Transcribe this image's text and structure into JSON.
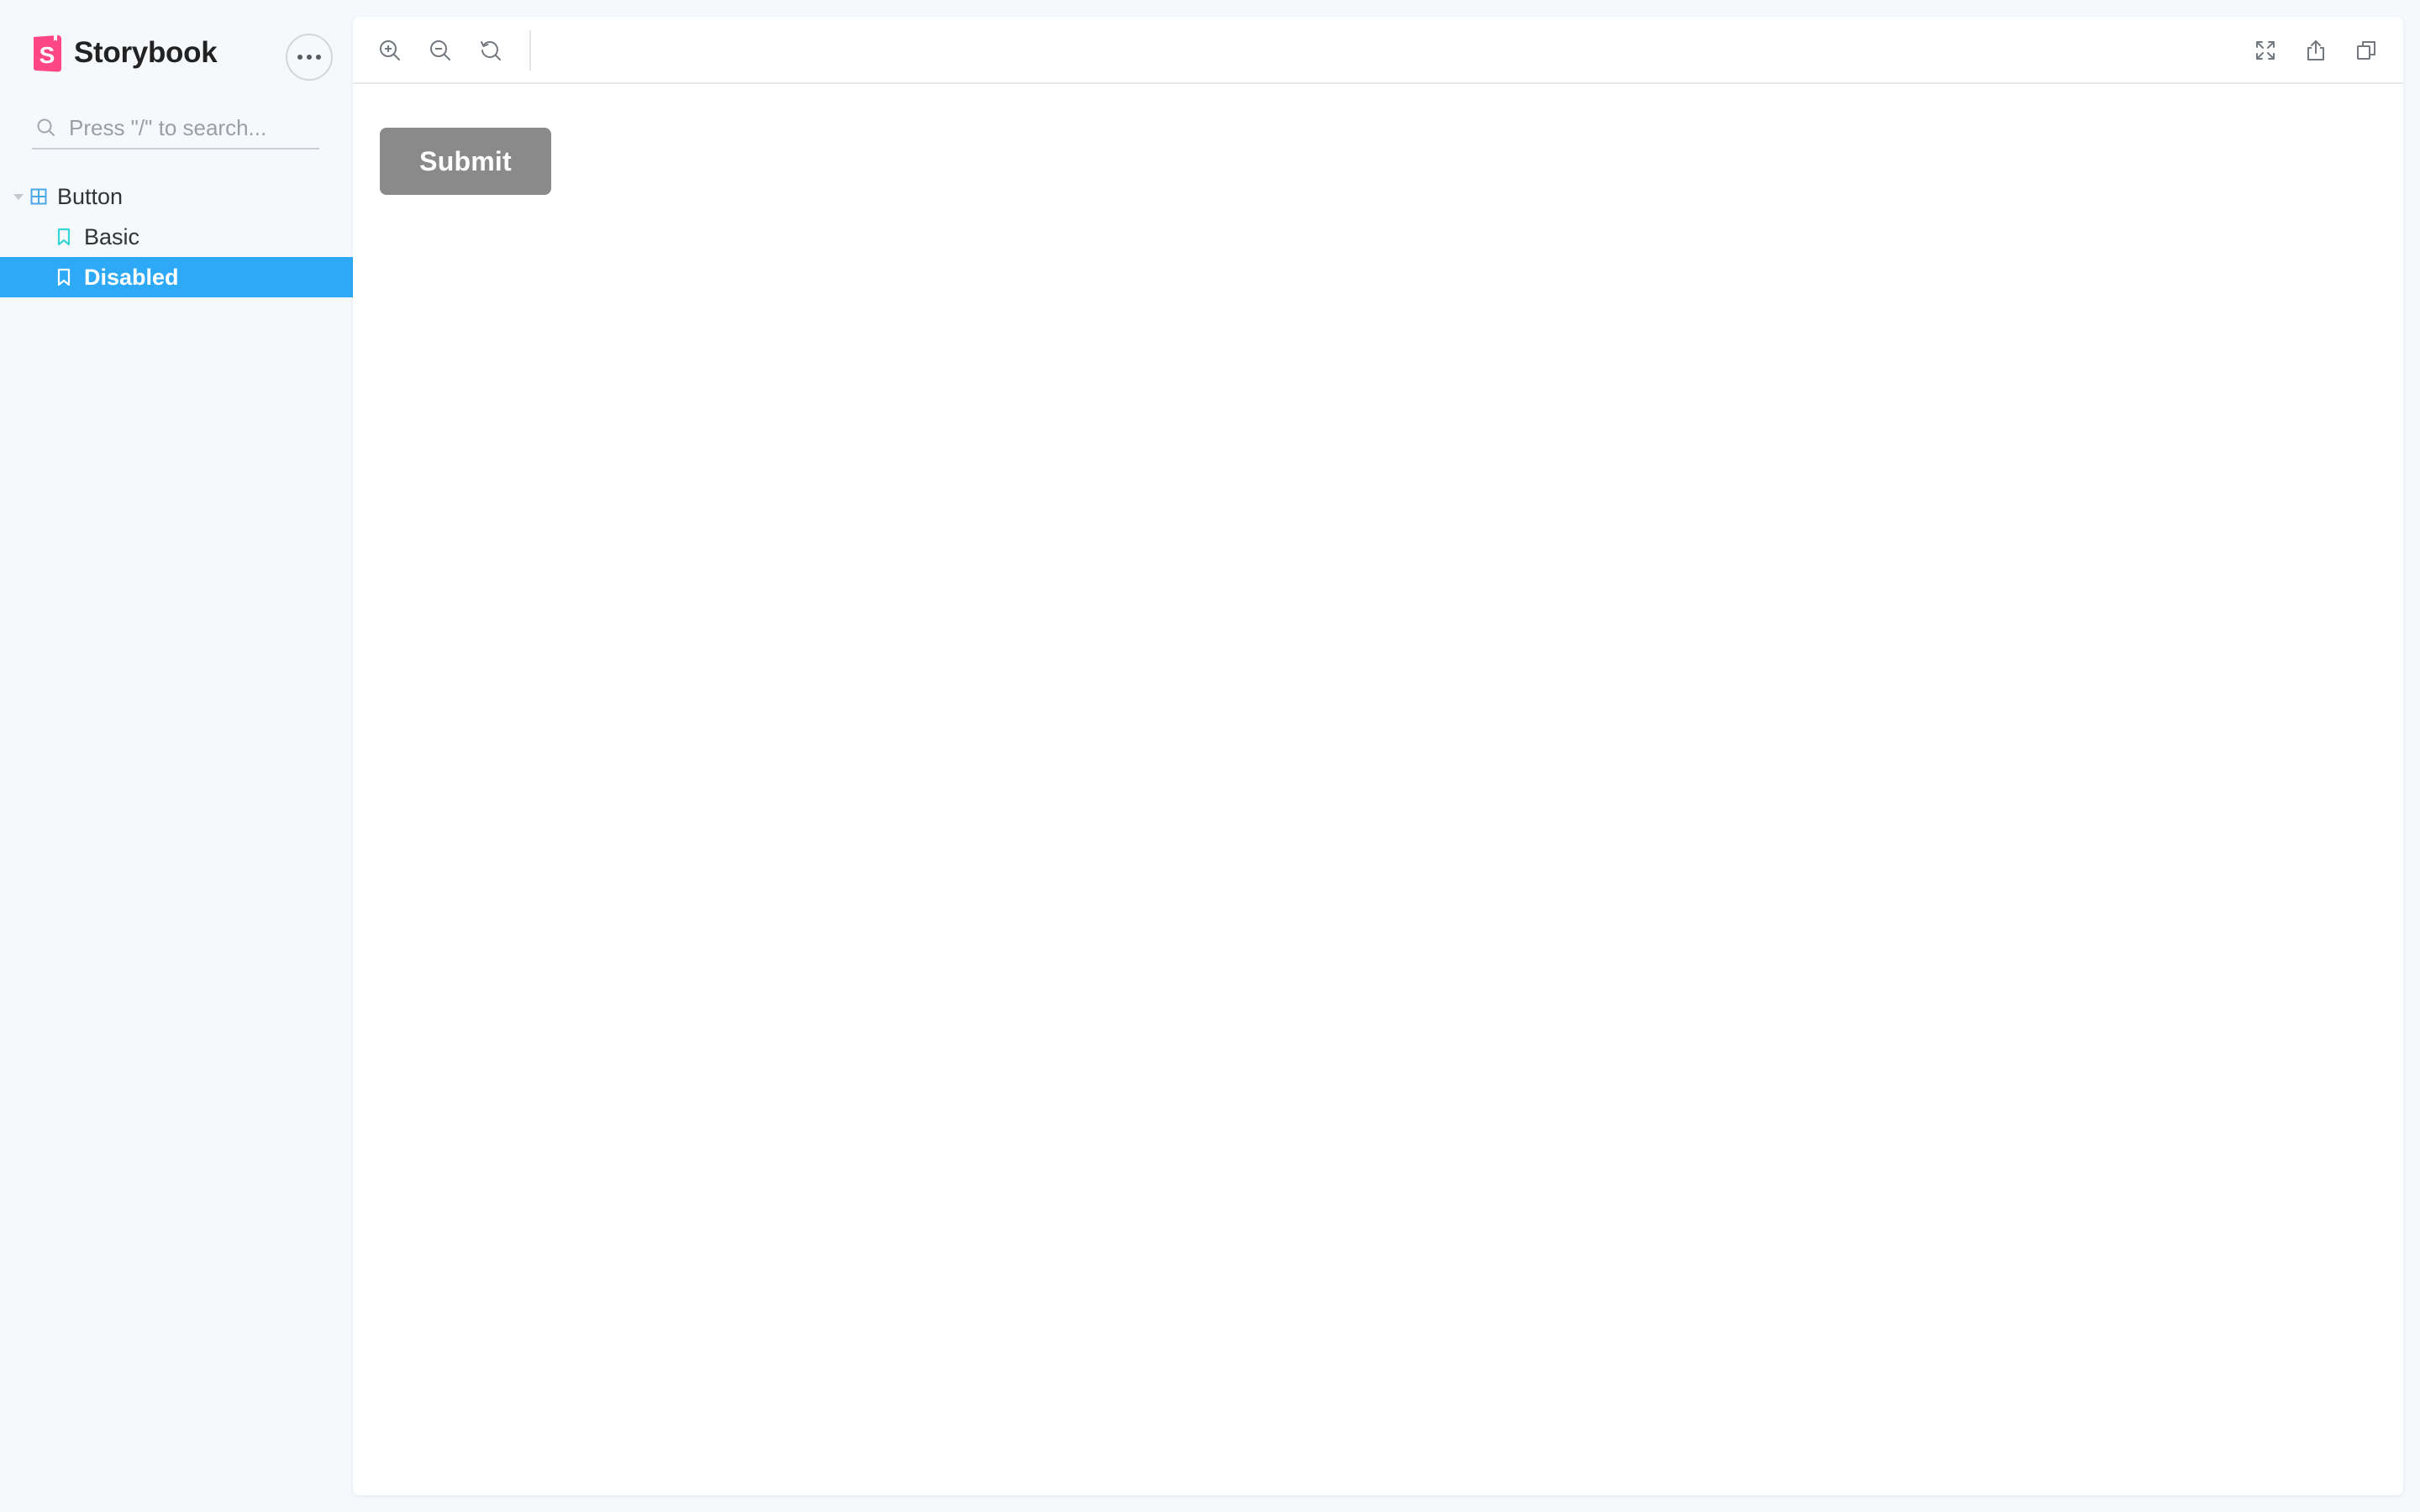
{
  "app": {
    "brand_name": "Storybook",
    "brand_color": "#ff4785",
    "menu_icon": "ellipsis-icon"
  },
  "search": {
    "placeholder": "Press \"/\" to search...",
    "value": "",
    "icon": "search-icon"
  },
  "sidebar": {
    "component": {
      "label": "Button",
      "expanded": true,
      "icon": "component-grid-icon"
    },
    "stories": [
      {
        "label": "Basic",
        "selected": false,
        "icon": "bookmark-icon"
      },
      {
        "label": "Disabled",
        "selected": true,
        "icon": "bookmark-icon"
      }
    ],
    "selected_color": "#2ea9f8"
  },
  "toolbar": {
    "left_tools": [
      "zoom-in-icon",
      "zoom-out-icon",
      "reset-zoom-icon"
    ],
    "right_tools": [
      "fullscreen-icon",
      "share-icon",
      "copy-icon"
    ]
  },
  "preview": {
    "button_label": "Submit",
    "button_disabled": true,
    "button_color": "#8a8a8a"
  }
}
